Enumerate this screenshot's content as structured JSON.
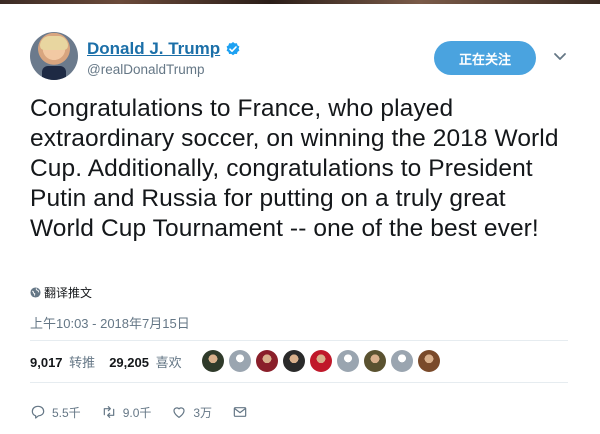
{
  "header": {
    "display_name": "Donald J. Trump",
    "handle": "@realDonaldTrump",
    "follow_label": "正在关注"
  },
  "tweet": {
    "text": "Congratulations to France, who played extraordinary soccer, on winning the 2018 World Cup. Additionally, congratulations to President Putin and Russia for putting on a truly great World Cup Tournament -- one of the best ever!",
    "translate_label": "翻译推文",
    "timestamp": "上午10:03 - 2018年7月15日"
  },
  "stats": {
    "retweets_count": "9,017",
    "retweets_label": "转推",
    "likes_count": "29,205",
    "likes_label": "喜欢"
  },
  "likers": [
    {
      "icon": "liker-avatar",
      "color": "#2f3a2a"
    },
    {
      "icon": "default-avatar",
      "color": "#9aa5b0"
    },
    {
      "icon": "liker-avatar",
      "color": "#8a1f2a"
    },
    {
      "icon": "liker-avatar",
      "color": "#2a2a2a"
    },
    {
      "icon": "liker-avatar",
      "color": "#c0182a"
    },
    {
      "icon": "default-avatar",
      "color": "#9aa5b0"
    },
    {
      "icon": "liker-avatar",
      "color": "#5a5230"
    },
    {
      "icon": "default-avatar",
      "color": "#9aa5b0"
    },
    {
      "icon": "liker-avatar",
      "color": "#7a4a2a"
    }
  ],
  "actions": {
    "reply_count": "5.5千",
    "retweet_count": "9.0千",
    "like_count": "3万"
  },
  "colors": {
    "accent": "#4aa3df",
    "name_link": "#1b6fa8",
    "secondary_text": "#657786"
  }
}
